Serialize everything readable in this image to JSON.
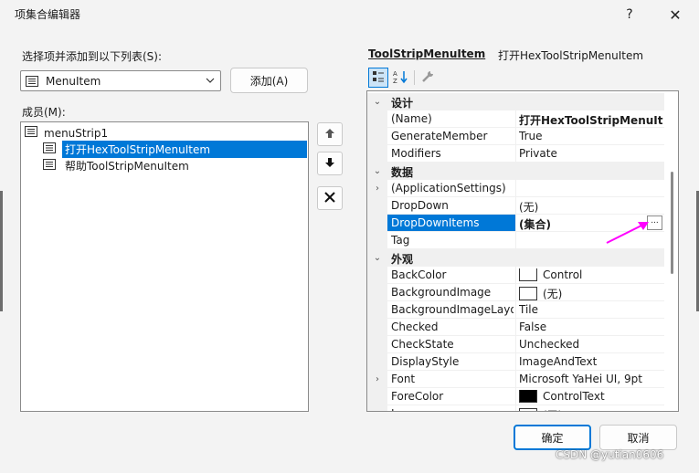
{
  "window": {
    "title": "项集合编辑器",
    "help_glyph": "?",
    "close_glyph": "✕"
  },
  "left": {
    "select_label": "选择项并添加到以下列表(S):",
    "type_select": {
      "value": "MenuItem",
      "icon": "menu-item-icon"
    },
    "add_button": "添加(A)",
    "members_label": "成员(M):",
    "tree": {
      "root": "menuStrip1",
      "children": [
        {
          "label": "打开HexToolStripMenuItem",
          "selected": true
        },
        {
          "label": "帮助ToolStripMenuItem",
          "selected": false
        }
      ]
    }
  },
  "side_buttons": {
    "up": "🡅",
    "down": "🡇",
    "delete": "✕"
  },
  "propertygrid": {
    "object_type": "ToolStripMenuItem",
    "object_name": "打开HexToolStripMenuItem",
    "rows": [
      {
        "kind": "category",
        "name": "设计",
        "toggle": "⌄"
      },
      {
        "kind": "prop",
        "name": "(Name)",
        "value": "打开HexToolStripMenuItem",
        "bold": true
      },
      {
        "kind": "prop",
        "name": "GenerateMember",
        "value": "True"
      },
      {
        "kind": "prop",
        "name": "Modifiers",
        "value": "Private"
      },
      {
        "kind": "category",
        "name": "数据",
        "toggle": "⌄"
      },
      {
        "kind": "prop",
        "name": "(ApplicationSettings)",
        "value": "",
        "expander": "›"
      },
      {
        "kind": "prop",
        "name": "DropDown",
        "value": "(无)"
      },
      {
        "kind": "prop",
        "name": "DropDownItems",
        "value": "(集合)",
        "bold": true,
        "selected": true,
        "ellipsis": "..."
      },
      {
        "kind": "prop",
        "name": "Tag",
        "value": ""
      },
      {
        "kind": "category",
        "name": "外观",
        "toggle": "⌄"
      },
      {
        "kind": "prop",
        "name": "BackColor",
        "value": "Control",
        "swatch": "#ffffff"
      },
      {
        "kind": "prop",
        "name": "BackgroundImage",
        "value": "(无)",
        "swatch": "#ffffff"
      },
      {
        "kind": "prop",
        "name": "BackgroundImageLayo",
        "value": "Tile"
      },
      {
        "kind": "prop",
        "name": "Checked",
        "value": "False"
      },
      {
        "kind": "prop",
        "name": "CheckState",
        "value": "Unchecked"
      },
      {
        "kind": "prop",
        "name": "DisplayStyle",
        "value": "ImageAndText"
      },
      {
        "kind": "prop",
        "name": "Font",
        "value": "Microsoft YaHei UI, 9pt",
        "expander": "›"
      },
      {
        "kind": "prop",
        "name": "ForeColor",
        "value": "ControlText",
        "swatch": "#000000"
      },
      {
        "kind": "prop",
        "name": "I",
        "value": "(无)",
        "swatch": "#ffffff"
      }
    ]
  },
  "footer": {
    "ok_button": "确定",
    "cancel_button": "取消"
  },
  "watermark": "CSDN @yutian0606",
  "colors": {
    "accent": "#0078d7",
    "annotation_arrow": "#ff00ff"
  }
}
